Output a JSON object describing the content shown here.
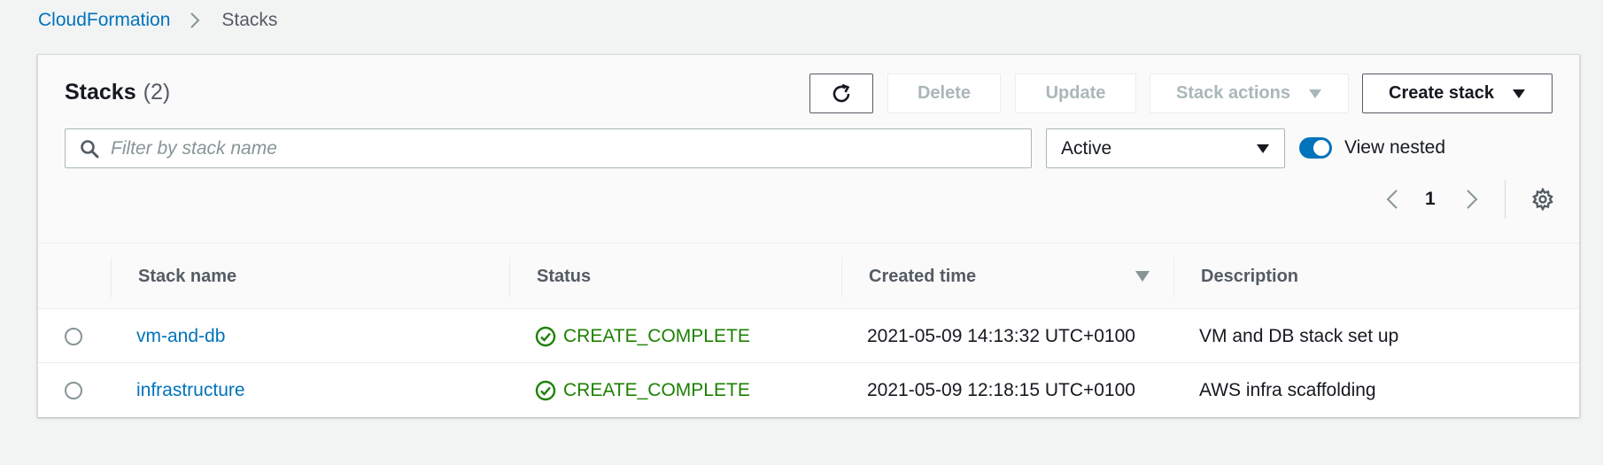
{
  "breadcrumb": {
    "parent": "CloudFormation",
    "current": "Stacks"
  },
  "panel": {
    "title": "Stacks",
    "count": "(2)"
  },
  "toolbar": {
    "delete_label": "Delete",
    "update_label": "Update",
    "stack_actions_label": "Stack actions",
    "create_stack_label": "Create stack"
  },
  "filter": {
    "placeholder": "Filter by stack name",
    "status_selected": "Active",
    "view_nested_label": "View nested",
    "view_nested_on": true
  },
  "pagination": {
    "current_page": "1"
  },
  "table": {
    "columns": [
      "Stack name",
      "Status",
      "Created time",
      "Description"
    ],
    "rows": [
      {
        "name": "vm-and-db",
        "status": "CREATE_COMPLETE",
        "created": "2021-05-09 14:13:32 UTC+0100",
        "description": "VM and DB stack set up"
      },
      {
        "name": "infrastructure",
        "status": "CREATE_COMPLETE",
        "created": "2021-05-09 12:18:15 UTC+0100",
        "description": "AWS infra scaffolding"
      }
    ]
  },
  "colors": {
    "link": "#0073bb",
    "success": "#1d8102",
    "background": "#f2f3f3",
    "toggle_on": "#0073bb"
  },
  "icons": {
    "refresh": "refresh-icon",
    "search": "search-icon",
    "caret": "caret-down-icon",
    "settings": "gear-icon",
    "status": "check-circle-icon"
  }
}
